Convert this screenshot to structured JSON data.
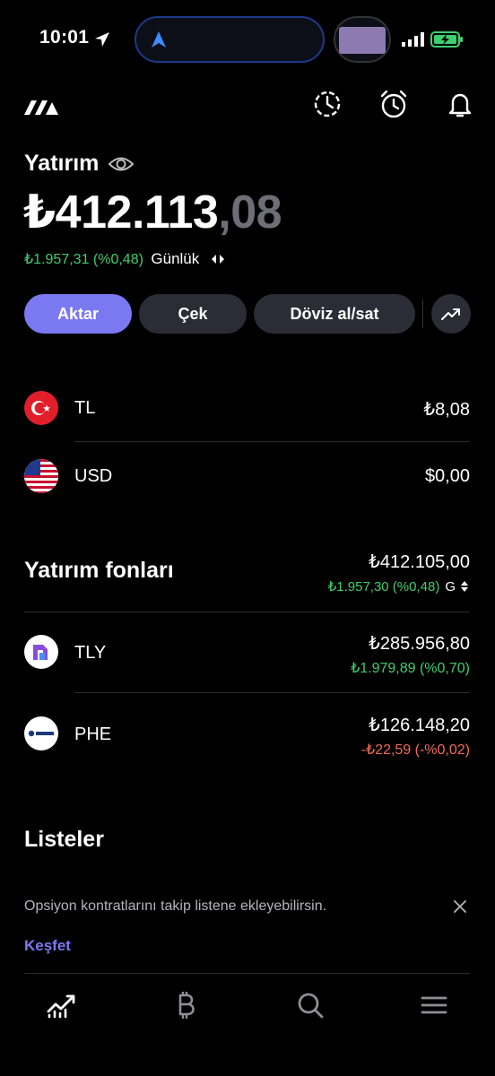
{
  "status_bar": {
    "time": "10:01"
  },
  "header": {
    "section_title": "Yatırım"
  },
  "balance": {
    "whole": "₺412.113",
    "fraction": ",08",
    "daily_change": "₺1.957,31 (%0,48)",
    "period": "Günlük"
  },
  "actions": {
    "transfer": "Aktar",
    "withdraw": "Çek",
    "fx": "Döviz al/sat"
  },
  "cash": [
    {
      "name": "TL",
      "value": "₺8,08"
    },
    {
      "name": "USD",
      "value": "$0,00"
    }
  ],
  "funds": {
    "title": "Yatırım fonları",
    "total": "₺412.105,00",
    "total_change": "₺1.957,30 (%0,48)",
    "period_short": "G",
    "items": [
      {
        "name": "TLY",
        "value": "₺285.956,80",
        "change": "₺1.979,89 (%0,70)",
        "trend": "up"
      },
      {
        "name": "PHE",
        "value": "₺126.148,20",
        "change": "-₺22,59 (-%0,02)",
        "trend": "down"
      }
    ]
  },
  "lists": {
    "title": "Listeler",
    "notice": "Opsiyon kontratlarını takip listene ekleyebilirsin.",
    "discover": "Keşfet"
  },
  "colors": {
    "accent": "#7b79f2",
    "positive": "#3ecf6d",
    "negative": "#f26b53",
    "pill": "#2c2c36"
  },
  "bottom_nav": [
    "portfolio-icon",
    "bitcoin-icon",
    "search-icon",
    "menu-icon"
  ]
}
